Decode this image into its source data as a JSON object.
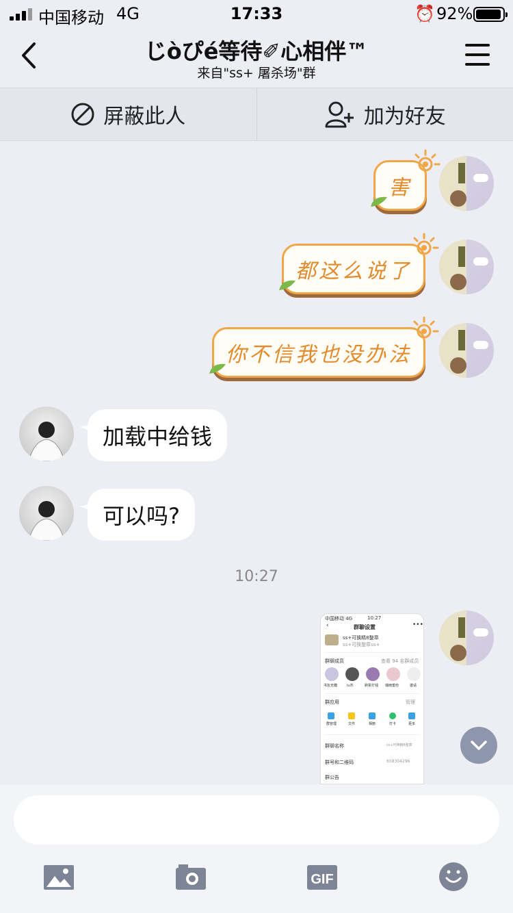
{
  "status_bar": {
    "carrier": "中国移动",
    "network": "4G",
    "time": "17:33",
    "battery_percent": "92%",
    "battery_level": 0.92
  },
  "header": {
    "title": "じòぴé等待✐心相伴™",
    "subtitle": "来自\"ss+ 屠杀场\"群"
  },
  "actions": {
    "block_label": "屏蔽此人",
    "add_friend_label": "加为好友"
  },
  "messages": [
    {
      "sender": "me",
      "type": "decorated",
      "text": "害"
    },
    {
      "sender": "me",
      "type": "decorated",
      "text": "都这么说了"
    },
    {
      "sender": "me",
      "type": "decorated",
      "text": "你不信我也没办法"
    },
    {
      "sender": "other",
      "type": "text",
      "text": "加载中给钱"
    },
    {
      "sender": "other",
      "type": "text",
      "text": "可以吗?"
    },
    {
      "type": "timestamp",
      "text": "10:27"
    },
    {
      "sender": "me",
      "type": "image",
      "text": ""
    }
  ],
  "thumbnail": {
    "status": "中国移动 4G",
    "time": "10:27",
    "title": "群聊设置",
    "group_name": "ss+可换精8整章",
    "group_sub": "ss+可换整章ss+",
    "members_label": "群聊成员",
    "members_count": "查看 94 名群成员",
    "members": [
      "书友无糖",
      "lu杰",
      "刷累打钱",
      "瑞雨蜜份",
      "邀请"
    ],
    "apps_label": "群应用",
    "apps_manage": "管理",
    "apps": [
      "群管理",
      "文件",
      "相册",
      "打卡",
      "更多"
    ],
    "name_label": "群聊名称",
    "name_value": "ss+可换精8整章",
    "qr_label": "群号和二维码",
    "qr_value": "658304296",
    "notice_label": "群公告"
  },
  "colors": {
    "background": "#eceef4",
    "bubble_border": "#f0a646",
    "bubble_text": "#e48a2a",
    "scroll_button": "#8e96ad",
    "icon_gray": "#7c8496"
  }
}
